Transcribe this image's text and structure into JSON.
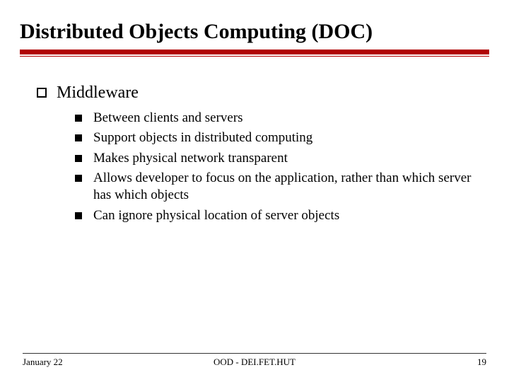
{
  "title": "Distributed Objects Computing (DOC)",
  "section": "Middleware",
  "bullets": [
    "Between clients and servers",
    "Support objects in distributed computing",
    "Makes physical network transparent",
    "Allows developer to focus on the application, rather than which server has which objects",
    "Can ignore physical location of server objects"
  ],
  "footer": {
    "date": "January 22",
    "center": "OOD - DEI.FET.HUT",
    "page": "19"
  }
}
